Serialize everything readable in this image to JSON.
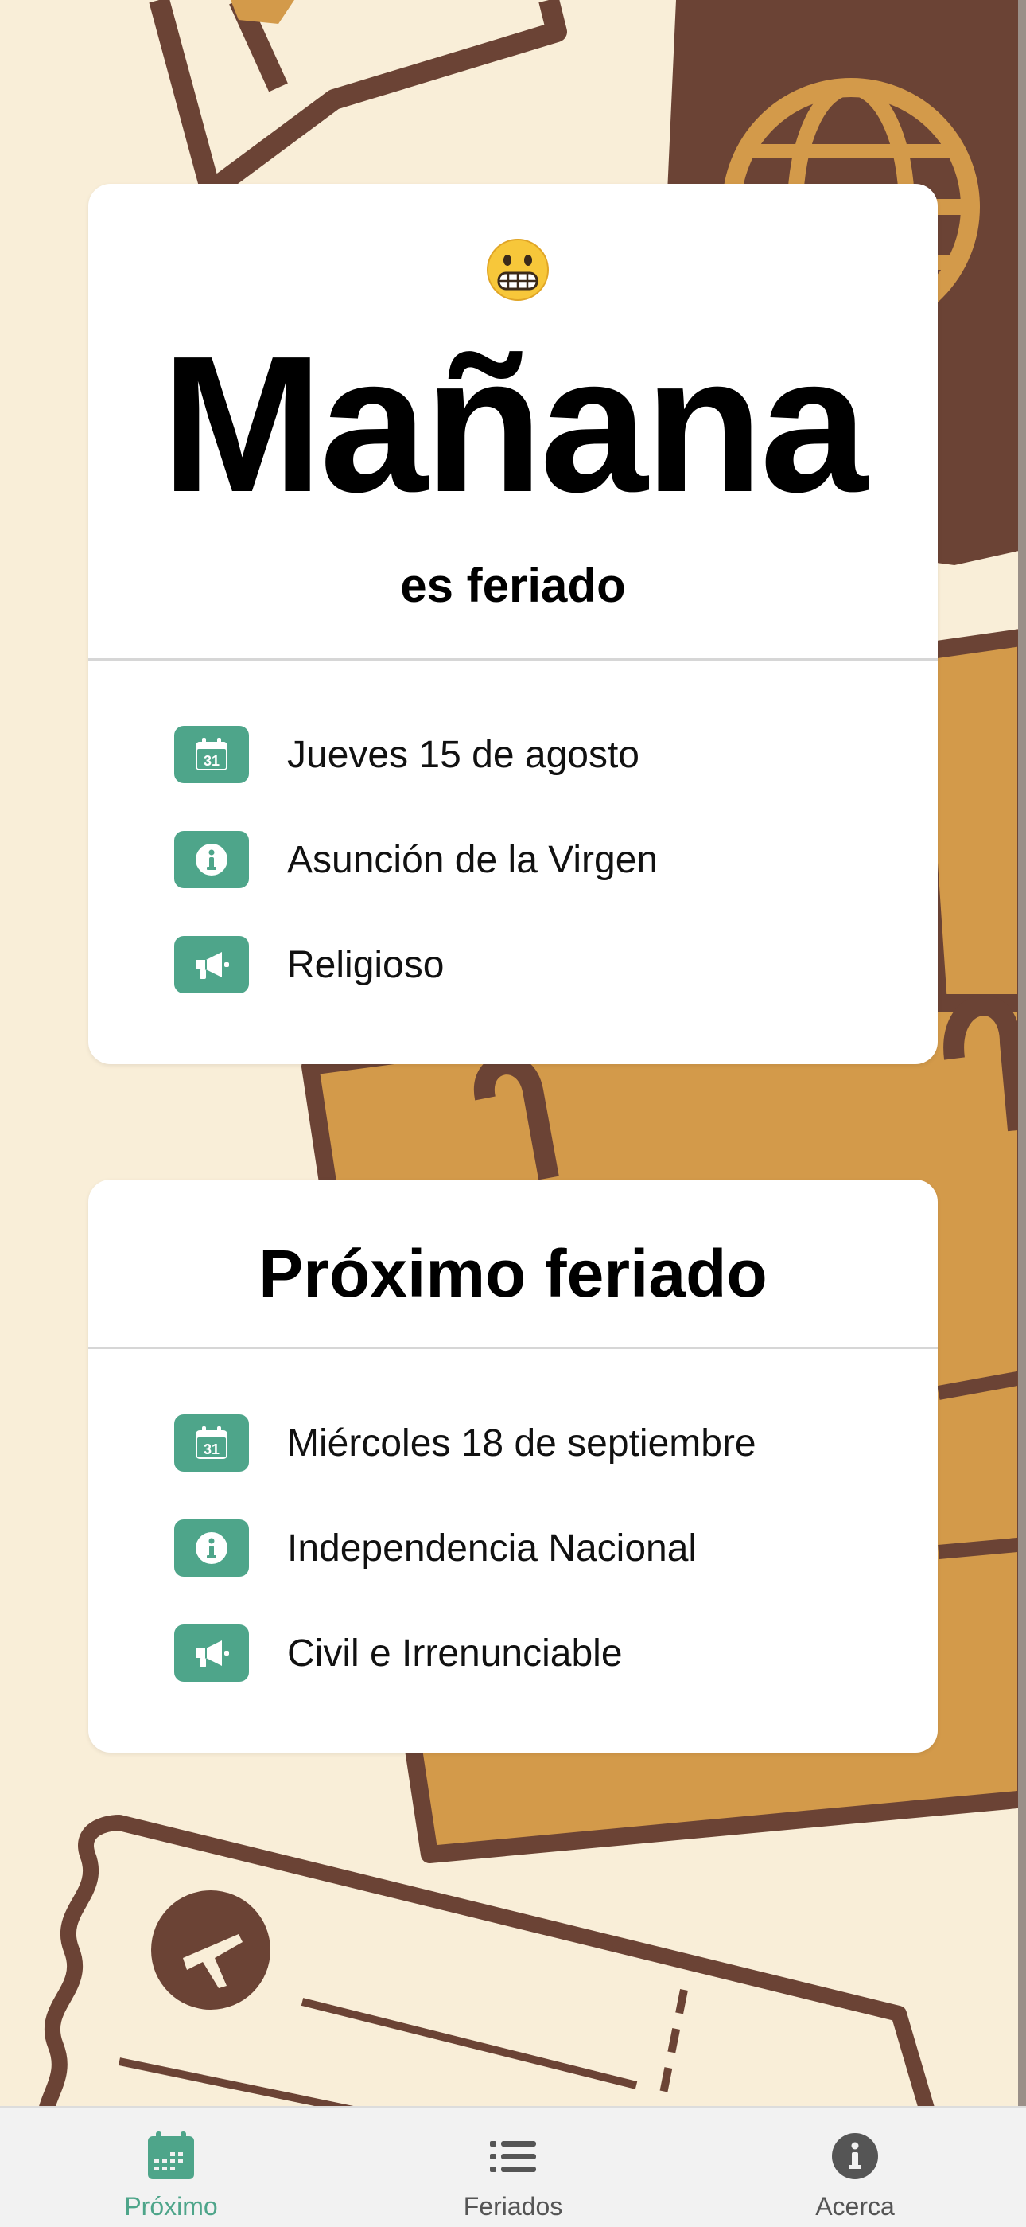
{
  "today_card": {
    "emoji": "grimacing-face",
    "title": "Mañana",
    "subtitle": "es feriado",
    "details": [
      {
        "icon": "calendar-icon",
        "text": "Jueves 15 de agosto"
      },
      {
        "icon": "info-icon",
        "text": "Asunción de la Virgen"
      },
      {
        "icon": "megaphone-icon",
        "text": "Religioso"
      }
    ]
  },
  "next_card": {
    "title": "Próximo feriado",
    "details": [
      {
        "icon": "calendar-icon",
        "text": "Miércoles 18 de septiembre"
      },
      {
        "icon": "info-icon",
        "text": "Independencia Nacional"
      },
      {
        "icon": "megaphone-icon",
        "text": "Civil e Irrenunciable"
      }
    ]
  },
  "tabbar": {
    "tabs": [
      {
        "label": "Próximo",
        "icon": "calendar-icon",
        "active": true
      },
      {
        "label": "Feriados",
        "icon": "list-icon",
        "active": false
      },
      {
        "label": "Acerca",
        "icon": "info-icon",
        "active": false
      }
    ]
  },
  "colors": {
    "accent": "#4ea58a",
    "background": "#f9eed8",
    "suitcase": "#d39a4a",
    "passport": "#6b4335"
  },
  "calendar_day": "31"
}
